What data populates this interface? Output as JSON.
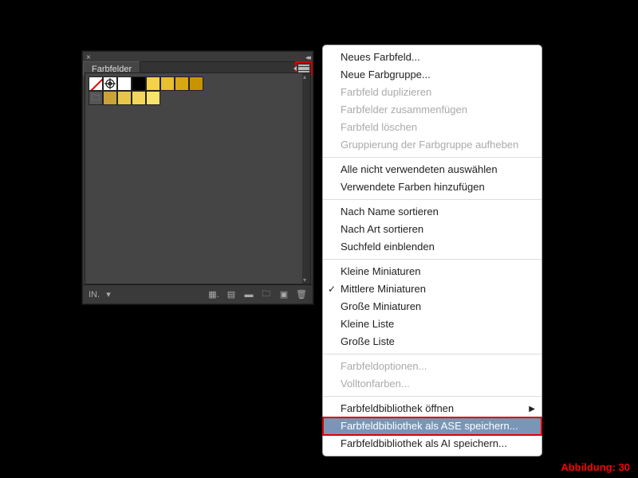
{
  "panel": {
    "title": "Farbfelder",
    "swatches_row1": [
      {
        "kind": "none"
      },
      {
        "kind": "reg"
      },
      {
        "kind": "color",
        "c": "#ffffff"
      },
      {
        "kind": "color",
        "c": "#000000"
      },
      {
        "kind": "color",
        "c": "#f5d24a"
      },
      {
        "kind": "color",
        "c": "#e8bf2e"
      },
      {
        "kind": "color",
        "c": "#d9a812"
      },
      {
        "kind": "color",
        "c": "#c79400"
      }
    ],
    "swatches_row2": [
      {
        "kind": "folder"
      },
      {
        "kind": "color",
        "c": "#caa23a"
      },
      {
        "kind": "color",
        "c": "#e8c64a"
      },
      {
        "kind": "color",
        "c": "#f2d85a"
      },
      {
        "kind": "color",
        "c": "#f8e36e"
      }
    ]
  },
  "footer": {
    "lib": "IN."
  },
  "menu": {
    "groups": [
      [
        {
          "label": "Neues Farbfeld...",
          "enabled": true
        },
        {
          "label": "Neue Farbgruppe...",
          "enabled": true
        },
        {
          "label": "Farbfeld duplizieren",
          "enabled": false
        },
        {
          "label": "Farbfelder zusammenfügen",
          "enabled": false
        },
        {
          "label": "Farbfeld löschen",
          "enabled": false
        },
        {
          "label": "Gruppierung der Farbgruppe aufheben",
          "enabled": false
        }
      ],
      [
        {
          "label": "Alle nicht verwendeten auswählen",
          "enabled": true
        },
        {
          "label": "Verwendete Farben hinzufügen",
          "enabled": true
        }
      ],
      [
        {
          "label": "Nach Name sortieren",
          "enabled": true
        },
        {
          "label": "Nach Art sortieren",
          "enabled": true
        },
        {
          "label": "Suchfeld einblenden",
          "enabled": true
        }
      ],
      [
        {
          "label": "Kleine Miniaturen",
          "enabled": true
        },
        {
          "label": "Mittlere Miniaturen",
          "enabled": true,
          "checked": true
        },
        {
          "label": "Große Miniaturen",
          "enabled": true
        },
        {
          "label": "Kleine Liste",
          "enabled": true
        },
        {
          "label": "Große Liste",
          "enabled": true
        }
      ],
      [
        {
          "label": "Farbfeldoptionen...",
          "enabled": false
        },
        {
          "label": "Volltonfarben...",
          "enabled": false
        }
      ],
      [
        {
          "label": "Farbfeldbibliothek öffnen",
          "enabled": true,
          "submenu": true
        },
        {
          "label": "Farbfeldbibliothek als ASE speichern...",
          "enabled": true,
          "highlight": true
        },
        {
          "label": "Farbfeldbibliothek als AI speichern...",
          "enabled": true
        }
      ]
    ]
  },
  "caption": "Abbildung: 30"
}
